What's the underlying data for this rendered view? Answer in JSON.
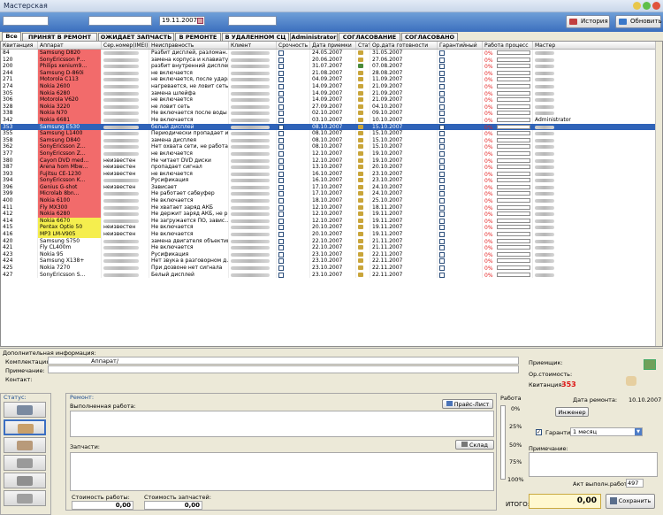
{
  "window": {
    "title": "Мастерская"
  },
  "toolbar": {
    "date": "19.11.2007",
    "history": "История",
    "refresh": "Обновить"
  },
  "tabs": [
    "Все",
    "ПРИНЯТ В РЕМОНТ",
    "ОЖИДАЕТ ЗАПЧАСТЬ",
    "В РЕМОНТЕ",
    "В УДАЛЕННОМ СЦ",
    "Administrator",
    "СОГЛАСОВАНИЕ",
    "СОГЛАСОВАНО"
  ],
  "columns": [
    "Квитанция",
    "Аппарат",
    "Сер.номер(IMEI)",
    "Неисправность",
    "Клиент",
    "Срочность",
    "Дата приемки",
    "Статус",
    "Ор.дата готовности",
    "Гарантийный",
    "Работа процесс",
    "Мастер"
  ],
  "rows": [
    [
      "84",
      "Samsung D820",
      "",
      "Разбит дисплей, разломан…",
      "",
      "",
      "24.05.2007",
      "b",
      "31.05.2007",
      "",
      "0%",
      "",
      "red"
    ],
    [
      "120",
      "SonyEricsson P…",
      "",
      "замена корпуса и клавиату…",
      "",
      "",
      "20.06.2007",
      "b",
      "27.06.2007",
      "",
      "0%",
      "",
      "red"
    ],
    [
      "200",
      "Philips xenium9…",
      "",
      "разбит внутренний дисплей",
      "",
      "",
      "31.07.2007",
      "g",
      "07.08.2007",
      "",
      "0%",
      "",
      "red"
    ],
    [
      "244",
      "Samsung D-860i",
      "",
      "не включается",
      "",
      "",
      "21.08.2007",
      "b",
      "28.08.2007",
      "",
      "0%",
      "",
      "red"
    ],
    [
      "271",
      "Motorola C113",
      "",
      "не включается, после удара",
      "",
      "",
      "04.09.2007",
      "b",
      "11.09.2007",
      "",
      "0%",
      "",
      "red"
    ],
    [
      "274",
      "Nokia 2600",
      "",
      "нагревается, не ловит сеть…",
      "",
      "",
      "14.09.2007",
      "b",
      "21.09.2007",
      "",
      "0%",
      "",
      "red"
    ],
    [
      "305",
      "Nokia 6280",
      "",
      "замена шлейфа",
      "",
      "",
      "14.09.2007",
      "b",
      "21.09.2007",
      "",
      "0%",
      "",
      "red"
    ],
    [
      "306",
      "Motorola V620",
      "",
      "не включается",
      "",
      "",
      "14.09.2007",
      "b",
      "21.09.2007",
      "",
      "0%",
      "",
      "red"
    ],
    [
      "328",
      "Nokia 3220",
      "",
      "не ловит сеть",
      "",
      "",
      "27.09.2007",
      "b",
      "04.10.2007",
      "",
      "0%",
      "",
      "red"
    ],
    [
      "338",
      "Nokia N70",
      "",
      "Не включается после воды",
      "",
      "",
      "02.10.2007",
      "b",
      "09.10.2007",
      "",
      "0%",
      "",
      "red"
    ],
    [
      "342",
      "Nokia 6681",
      "",
      "Не включается",
      "",
      "",
      "03.10.2007",
      "b",
      "10.10.2007",
      "",
      "0%",
      "Administrator",
      "red"
    ],
    [
      "353",
      "Samsung E530",
      "",
      "белый дисплей",
      "",
      "",
      "08.10.2007",
      "b",
      "15.10.2007",
      "",
      "0%",
      "",
      "sel"
    ],
    [
      "355",
      "Samsung L1400",
      "",
      "Периодически пропадает и…",
      "",
      "",
      "08.10.2007",
      "b",
      "15.10.2007",
      "",
      "0%",
      "",
      "red"
    ],
    [
      "358",
      "Samsung D840",
      "",
      "замена дисплея",
      "",
      "",
      "08.10.2007",
      "b",
      "15.10.2007",
      "",
      "0%",
      "",
      "red"
    ],
    [
      "362",
      "SonyEricsson Z…",
      "",
      "Нет охвата сети, не работа…",
      "",
      "",
      "08.10.2007",
      "b",
      "15.10.2007",
      "",
      "0%",
      "",
      "red"
    ],
    [
      "377",
      "SonyEricsson Z…",
      "",
      "не включается",
      "",
      "",
      "12.10.2007",
      "b",
      "19.10.2007",
      "",
      "0%",
      "",
      "red"
    ],
    [
      "380",
      "Сауоп DVD med…",
      "неизвестен",
      "Не читает DVD диски",
      "",
      "",
      "12.10.2007",
      "b",
      "19.10.2007",
      "",
      "0%",
      "",
      "red"
    ],
    [
      "387",
      "Arena hom Mbw…",
      "неизвестен",
      "пропадает сигнал",
      "",
      "",
      "13.10.2007",
      "b",
      "20.10.2007",
      "",
      "0%",
      "",
      "red"
    ],
    [
      "393",
      "Fujitsu CE-1230",
      "неизвестен",
      "не включается",
      "",
      "",
      "16.10.2007",
      "b",
      "23.10.2007",
      "",
      "0%",
      "",
      "red"
    ],
    [
      "394",
      "SonyEricsson K…",
      "",
      "Русификация",
      "",
      "",
      "16.10.2007",
      "b",
      "23.10.2007",
      "",
      "0%",
      "",
      "red"
    ],
    [
      "396",
      "Genius G-shot",
      "неизвестен",
      "Зависает",
      "",
      "",
      "17.10.2007",
      "b",
      "24.10.2007",
      "",
      "0%",
      "",
      "red"
    ],
    [
      "399",
      "Microlab 8bn…",
      "",
      "Не работает сабвуфер",
      "",
      "",
      "17.10.2007",
      "b",
      "24.10.2007",
      "",
      "0%",
      "",
      "red"
    ],
    [
      "400",
      "Nokia 6100",
      "",
      "Не включается",
      "",
      "",
      "18.10.2007",
      "b",
      "25.10.2007",
      "",
      "0%",
      "",
      "red"
    ],
    [
      "411",
      "Fly MX300",
      "",
      "Не хватает заряд АКБ",
      "",
      "",
      "12.10.2007",
      "b",
      "18.11.2007",
      "",
      "0%",
      "",
      "red"
    ],
    [
      "412",
      "Nokia 6280",
      "",
      "Не держит заряд АКБ, не р…",
      "",
      "",
      "12.10.2007",
      "b",
      "19.11.2007",
      "",
      "0%",
      "",
      "red"
    ],
    [
      "414",
      "Nokia 6670",
      "",
      "Не загружается ПО, завис…",
      "",
      "",
      "12.10.2007",
      "b",
      "19.11.2007",
      "",
      "0%",
      "",
      "yellow"
    ],
    [
      "415",
      "Pentax Optio 50",
      "неизвестен",
      "Не включается",
      "",
      "",
      "20.10.2007",
      "b",
      "19.11.2007",
      "",
      "0%",
      "",
      "yellow"
    ],
    [
      "416",
      "MP3 LM-V905",
      "неизвестен",
      "Не включается",
      "",
      "",
      "20.10.2007",
      "b",
      "19.11.2007",
      "",
      "0%",
      "",
      "yellow"
    ],
    [
      "420",
      "Samsung S750",
      "",
      "замена двигателя объектив…",
      "",
      "",
      "22.10.2007",
      "b",
      "21.11.2007",
      "",
      "0%",
      "",
      ""
    ],
    [
      "421",
      "Fly CL400m",
      "",
      "Не включается",
      "",
      "",
      "22.10.2007",
      "b",
      "21.11.2007",
      "",
      "0%",
      "",
      ""
    ],
    [
      "423",
      "Nokia 95",
      "",
      "Русификация",
      "",
      "",
      "23.10.2007",
      "b",
      "22.11.2007",
      "",
      "0%",
      "",
      ""
    ],
    [
      "424",
      "Samsung X138+",
      "",
      "Нет звука в разговорном д…",
      "",
      "",
      "23.10.2007",
      "b",
      "22.11.2007",
      "",
      "0%",
      "",
      ""
    ],
    [
      "425",
      "Nokia 7270",
      "",
      "При дозвоне нет сигнала",
      "",
      "",
      "23.10.2007",
      "b",
      "22.11.2007",
      "",
      "0%",
      "",
      ""
    ],
    [
      "427",
      "SonyEricsson S…",
      "",
      "Белый дисплей",
      "",
      "",
      "23.10.2007",
      "b",
      "22.11.2007",
      "",
      "0%",
      "",
      ""
    ]
  ],
  "details": {
    "section": "Дополнительная информация:",
    "completeness_label": "Комплектация:",
    "completeness_value": "Аппарат/",
    "note_label": "Примечание:",
    "contact_label": "Контакт:",
    "receiver_label": "Приемщик:",
    "cost_label": "Ор.стоимость:",
    "receipt_label": "Квитанция:",
    "receipt_value": "353"
  },
  "status_label": "Статус:",
  "repair": {
    "section": "Ремонт:",
    "done_work": "Выполненная работа:",
    "pricelist": "Прайс-Лист",
    "parts": "Запчасти:",
    "warehouse": "Склад",
    "work_cost_label": "Стоимость работы:",
    "work_cost": "0,00",
    "parts_cost_label": "Стоимость запчастей:",
    "parts_cost": "0,00",
    "total_label": "ИТОГО:",
    "total": "0,00",
    "save": "Сохранить"
  },
  "work": {
    "label": "Работа",
    "levels": [
      "0%",
      "25%",
      "50%",
      "75%",
      "100%"
    ]
  },
  "right": {
    "repair_date_label": "Дата ремонта:",
    "repair_date": "10.10.2007",
    "engineer": "Инженер",
    "warranty_label": "Гарантия",
    "warranty_value": "1 месяц",
    "note_label": "Примечание:",
    "act_label": "Акт выполн.работ:",
    "act_value": "497"
  }
}
